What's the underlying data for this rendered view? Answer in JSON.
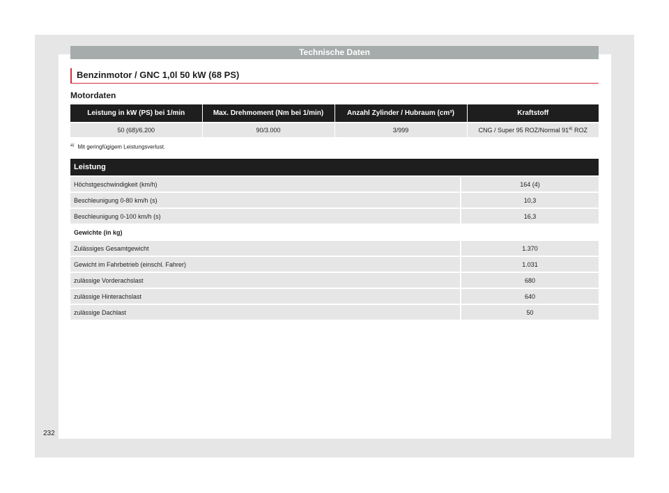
{
  "header": {
    "title": "Technische Daten"
  },
  "section": {
    "title": "Benzinmotor / GNC 1,0l 50 kW (68 PS)"
  },
  "motordaten": {
    "title": "Motordaten",
    "columns": [
      "Leistung in kW (PS) bei 1/min",
      "Max. Drehmoment (Nm bei 1/min)",
      "Anzahl Zylinder / Hubraum (cm³)",
      "Kraftstoff"
    ],
    "row": {
      "power": "50 (68)/6.200",
      "torque": "90/3.000",
      "cylinders": "3/999",
      "fuel_before": "CNG / Super 95 ROZ/Normal 91",
      "fuel_mark": "a)",
      "fuel_after": " ROZ"
    }
  },
  "footnote": {
    "mark": "a)",
    "text": "Mit geringfügigem Leistungsverlust."
  },
  "leistung": {
    "title": "Leistung",
    "rows": [
      {
        "label": "Höchstgeschwindigkeit (km/h)",
        "value": "164 (4)"
      },
      {
        "label": "Beschleunigung 0-80 km/h (s)",
        "value": "10,3"
      },
      {
        "label": "Beschleunigung 0-100 km/h (s)",
        "value": "16,3"
      }
    ],
    "weights_title": "Gewichte (in kg)",
    "weights": [
      {
        "label": "Zulässiges Gesamtgewicht",
        "value": "1.370"
      },
      {
        "label": "Gewicht im Fahrbetrieb (einschl. Fahrer)",
        "value": "1.031"
      },
      {
        "label": "zulässige Vorderachslast",
        "value": "680"
      },
      {
        "label": "zulässige Hinterachslast",
        "value": "640"
      },
      {
        "label": "zulässige Dachlast",
        "value": "50"
      }
    ]
  },
  "page": {
    "number": "232"
  },
  "colors": {
    "accent": "#d62d3c",
    "header_bar": "#a6acab",
    "table_header": "#1e1e1e",
    "row_bg": "#e6e6e6"
  }
}
